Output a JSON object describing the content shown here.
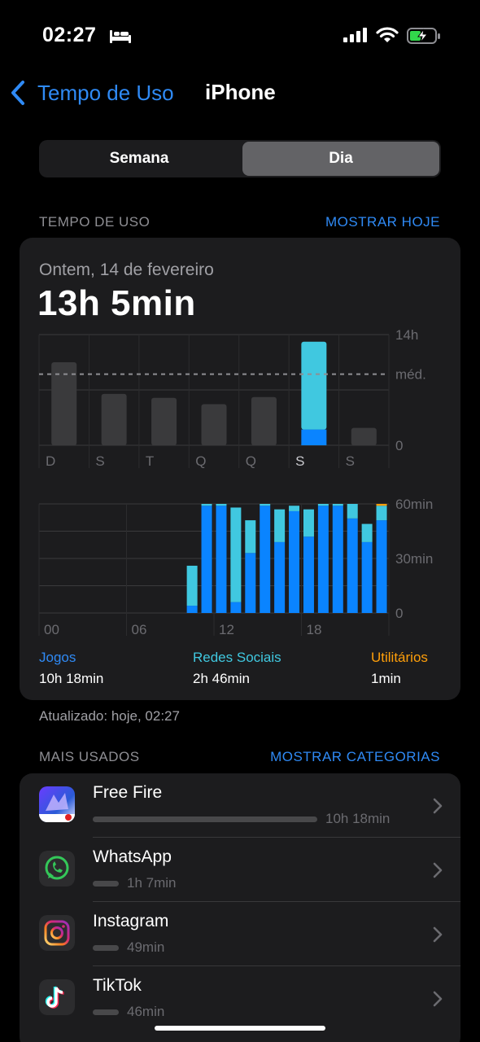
{
  "status": {
    "time": "02:27",
    "battery_charging": true
  },
  "nav": {
    "back_label": "Tempo de Uso",
    "title": "iPhone"
  },
  "segmented": {
    "options": [
      "Semana",
      "Dia"
    ],
    "selected": "Dia"
  },
  "usage_section": {
    "header": "TEMPO DE USO",
    "link": "MOSTRAR HOJE"
  },
  "card": {
    "date": "Ontem, 14 de fevereiro",
    "total": "13h 5min"
  },
  "colors": {
    "blue": "#0a84ff",
    "cyan": "#40c8e0",
    "orange": "#ff9f0a",
    "grey_bar": "#3a3a3c",
    "link": "#2f8af5"
  },
  "chart_data": [
    {
      "type": "bar",
      "categories": [
        "D",
        "S",
        "T",
        "Q",
        "Q",
        "S",
        "S"
      ],
      "highlighted_category_index": 5,
      "series": [
        {
          "values": [
            10.5,
            6.5,
            6.0,
            5.2,
            6.1,
            2.0,
            2.2
          ]
        },
        {
          "values": [
            0,
            0,
            0,
            0,
            0,
            11.1,
            0
          ]
        }
      ],
      "y_ticks": [
        "14h",
        "méd.",
        "0"
      ],
      "ylim": [
        0,
        14
      ],
      "average": 9.0
    },
    {
      "type": "bar",
      "stacked": true,
      "categories": [
        "0",
        "1",
        "2",
        "3",
        "4",
        "5",
        "6",
        "7",
        "8",
        "9",
        "10",
        "11",
        "12",
        "13",
        "14",
        "15",
        "16",
        "17",
        "18",
        "19",
        "20",
        "21",
        "22",
        "23"
      ],
      "x_tick_labels": [
        "00",
        "06",
        "12",
        "18"
      ],
      "series": [
        {
          "name": "Jogos",
          "values": [
            0,
            0,
            0,
            0,
            0,
            0,
            0,
            0,
            0,
            0,
            4,
            59,
            59,
            6,
            33,
            59,
            39,
            56,
            42,
            59,
            59,
            52,
            39,
            51
          ]
        },
        {
          "name": "Redes Sociais",
          "values": [
            0,
            0,
            0,
            0,
            0,
            0,
            0,
            0,
            0,
            0,
            22,
            1,
            1,
            52,
            18,
            1,
            18,
            3,
            15,
            1,
            1,
            8,
            10,
            8
          ]
        },
        {
          "name": "Utilitários",
          "values": [
            0,
            0,
            0,
            0,
            0,
            0,
            0,
            0,
            0,
            0,
            0,
            0,
            0,
            0,
            0,
            0,
            0,
            0,
            0,
            0,
            0,
            0,
            0,
            1
          ]
        }
      ],
      "y_ticks": [
        "60min",
        "30min",
        "0"
      ],
      "ylim": [
        0,
        60
      ]
    }
  ],
  "legend": [
    {
      "name": "Jogos",
      "value": "10h 18min",
      "color": "#0a84ff"
    },
    {
      "name": "Redes Sociais",
      "value": "2h 46min",
      "color": "#40c8e0"
    },
    {
      "name": "Utilitários",
      "value": "1min",
      "color": "#ff9f0a"
    }
  ],
  "updated": "Atualizado: hoje, 02:27",
  "most_used": {
    "header": "MAIS USADOS",
    "link": "MOSTRAR CATEGORIAS",
    "apps": [
      {
        "name": "Free Fire",
        "time": "10h 18min",
        "fraction": 1.0,
        "icon": "free-fire-icon"
      },
      {
        "name": "WhatsApp",
        "time": "1h 7min",
        "fraction": 0.11,
        "icon": "whatsapp-icon"
      },
      {
        "name": "Instagram",
        "time": "49min",
        "fraction": 0.08,
        "icon": "instagram-icon"
      },
      {
        "name": "TikTok",
        "time": "46min",
        "fraction": 0.075,
        "icon": "tiktok-icon"
      }
    ]
  }
}
